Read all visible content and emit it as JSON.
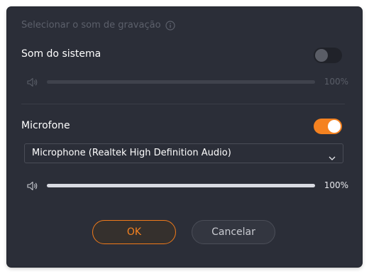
{
  "dialog": {
    "section_title": "Selecionar o som de gravação",
    "system_sound": {
      "label": "Som do sistema",
      "enabled": false,
      "volume_percent": 100,
      "volume_text": "100%"
    },
    "microphone": {
      "label": "Microfone",
      "enabled": true,
      "device": "Microphone (Realtek High Definition Audio)",
      "volume_percent": 100,
      "volume_text": "100%"
    },
    "buttons": {
      "ok_label": "OK",
      "cancel_label": "Cancelar"
    }
  },
  "colors": {
    "accent": "#f58220",
    "background": "#2b2e38"
  },
  "icons": {
    "info": "info-icon",
    "speaker": "speaker-icon",
    "dropdown": "chevron-down-icon"
  }
}
